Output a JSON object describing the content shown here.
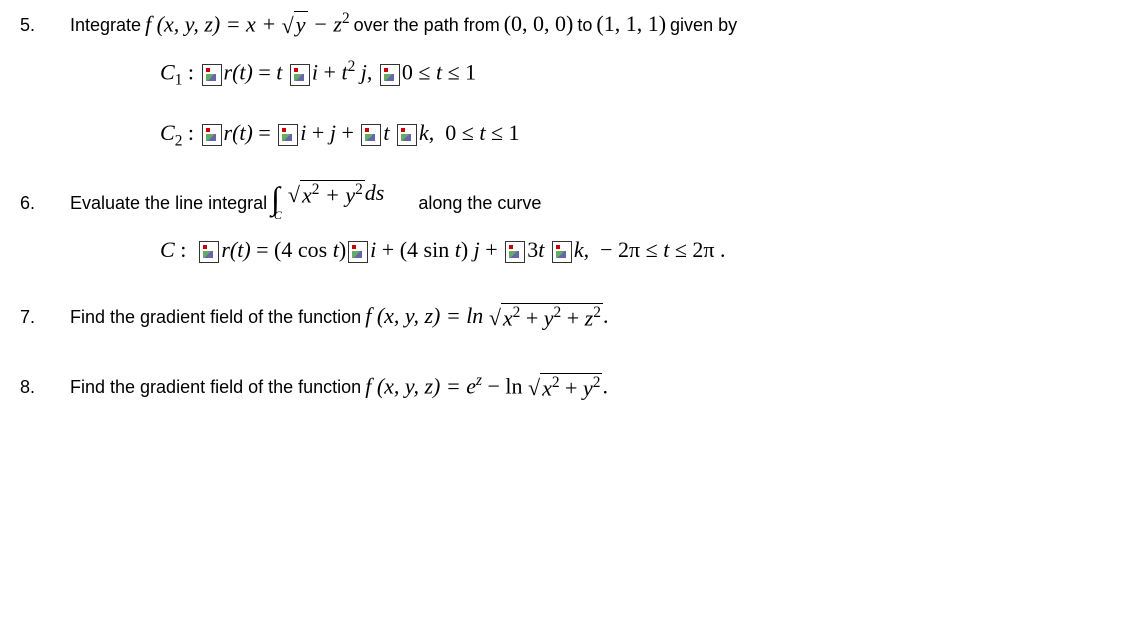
{
  "problems": {
    "p5": {
      "num": "5.",
      "lead": "Integrate",
      "fn": "f (x, y, z) = x + ",
      "sqrt_body": "y",
      "after_sqrt": " − z",
      "after_sqrt_sup": "2",
      "mid": "over the path from",
      "pt1": "(0, 0, 0)",
      "to": "to",
      "pt2": "(1, 1, 1)",
      "tail": "given by",
      "c1_label": "C",
      "c1_sub": "1",
      "c1_colon": " :  ",
      "c1_rt": "r(t) = t i + t",
      "c1_sup": "2",
      "c1_j": " j, ",
      "c1_range": "0 ≤ t ≤ 1",
      "c2_label": "C",
      "c2_sub": "2",
      "c2_colon": " :  ",
      "c2_rt": "r(t) = i + j + t k,   0 ≤ t ≤ 1"
    },
    "p6": {
      "num": "6.",
      "lead": "Evaluate the line integral",
      "int_body_pre": "x",
      "int_body_sup1": "2",
      "int_body_mid": " + y",
      "int_body_sup2": "2",
      "int_ds": "  ds",
      "tail": "along the curve",
      "c_label": "C :  r(t) = (4 cos t) i + (4 sin t) j + 3t k,   − 2π ≤ t ≤ 2π ."
    },
    "p7": {
      "num": "7.",
      "lead": "Find the gradient field of the function",
      "fn_pre": "f (x, y, z) = ln ",
      "sqrt_body": "x² + y² + z²",
      "period": "."
    },
    "p8": {
      "num": "8.",
      "lead": "Find the gradient field of the function",
      "fn_pre": "f (x, y, z) = e",
      "fn_sup": "z",
      "fn_mid": " − ln ",
      "sqrt_body": "x² + y²",
      "period": "."
    }
  }
}
